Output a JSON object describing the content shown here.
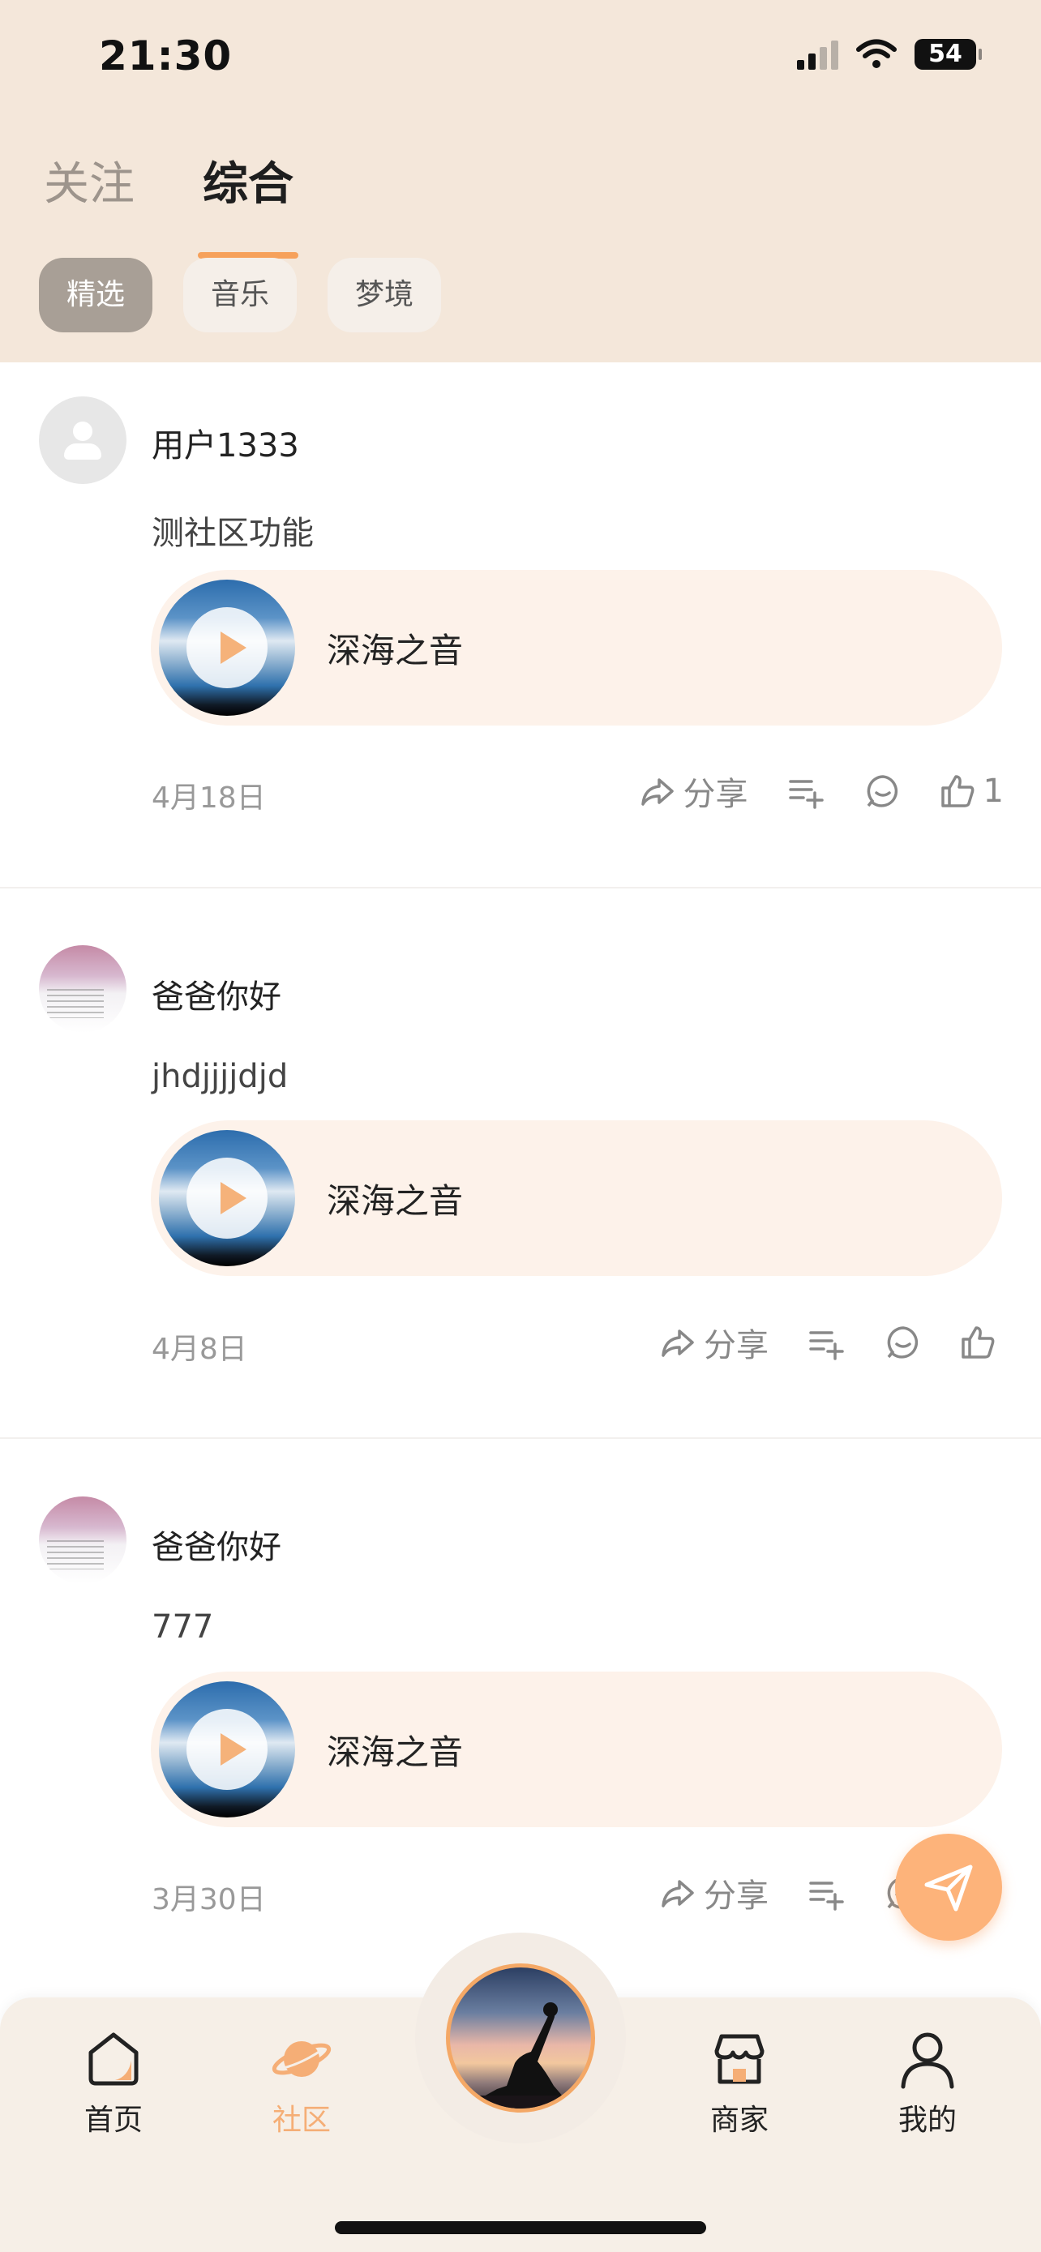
{
  "status": {
    "time": "21:30",
    "battery": "54"
  },
  "tabs": [
    {
      "label": "关注"
    },
    {
      "label": "综合"
    }
  ],
  "chips": [
    {
      "label": "精选"
    },
    {
      "label": "音乐"
    },
    {
      "label": "梦境"
    }
  ],
  "posts": [
    {
      "user": "用户1333",
      "text": "测社区功能",
      "track": "深海之音",
      "date": "4月18日",
      "share": "分享",
      "likes": "1"
    },
    {
      "user": "爸爸你好",
      "text": "jhdjjjjdjd",
      "track": "深海之音",
      "date": "4月8日",
      "share": "分享",
      "likes": ""
    },
    {
      "user": "爸爸你好",
      "text": "777",
      "track": "深海之音",
      "date": "3月30日",
      "share": "分享",
      "likes": ""
    }
  ],
  "nav": [
    {
      "label": "首页"
    },
    {
      "label": "社区"
    },
    {
      "label": "商家"
    },
    {
      "label": "我的"
    }
  ],
  "colors": {
    "header_bg": "#f4e7da",
    "accent": "#f6a15b",
    "track_bg": "#fdf2ea"
  }
}
